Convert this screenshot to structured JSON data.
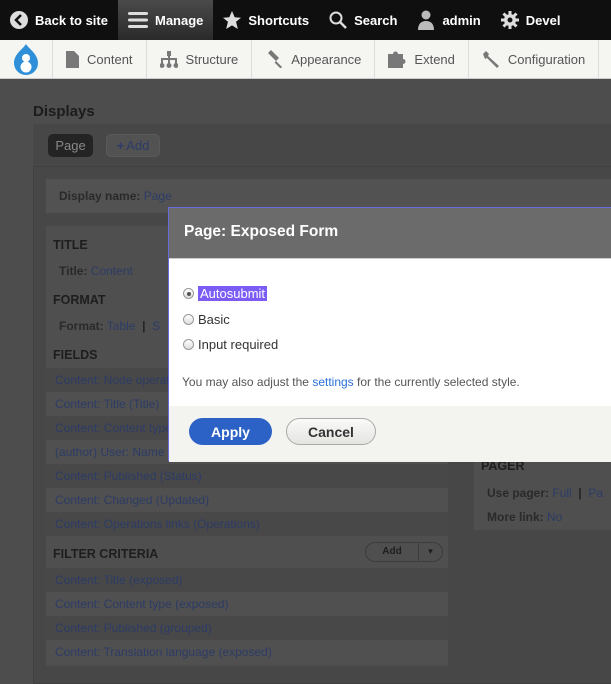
{
  "toolbar": {
    "items": [
      {
        "label": "Back to site",
        "icon": "chevron-left-circle-icon"
      },
      {
        "label": "Manage",
        "icon": "hamburger-icon"
      },
      {
        "label": "Shortcuts",
        "icon": "star-icon"
      },
      {
        "label": "Search",
        "icon": "search-icon"
      },
      {
        "label": "admin",
        "icon": "user-icon"
      },
      {
        "label": "Devel",
        "icon": "gear-icon"
      }
    ]
  },
  "tray": {
    "items": [
      {
        "label": "Content",
        "icon": "file-icon"
      },
      {
        "label": "Structure",
        "icon": "sitemap-icon"
      },
      {
        "label": "Appearance",
        "icon": "paintbrush-icon"
      },
      {
        "label": "Extend",
        "icon": "puzzle-icon"
      },
      {
        "label": "Configuration",
        "icon": "wrench-icon"
      }
    ]
  },
  "displays": {
    "heading": "Displays",
    "tab_page": "Page",
    "add": "Add",
    "display_name_label": "Display name:",
    "display_name": "Page"
  },
  "title_section": {
    "heading": "TITLE",
    "label": "Title:",
    "value": "Content"
  },
  "format_section": {
    "heading": "FORMAT",
    "label": "Format:",
    "value": "Table",
    "sep": "|",
    "value2": "S"
  },
  "fields": {
    "heading": "FIELDS",
    "items": [
      "Content: Node operat",
      "Content: Title (Title)",
      "Content: Content type",
      "(author) User: Name",
      "Content: Published (Status)",
      "Content: Changed (Updated)",
      "Content: Operations links (Operations)"
    ]
  },
  "filters": {
    "heading": "FILTER CRITERIA",
    "add": "Add",
    "items": [
      "Content: Title (exposed)",
      "Content: Content type (exposed)",
      "Content: Published (grouped)",
      "Content: Translation language (exposed)"
    ]
  },
  "pager": {
    "heading": "PAGER",
    "use_pager_label": "Use pager:",
    "use_pager": "Full",
    "sep": "|",
    "use_pager2": "Pa",
    "more_link_label": "More link:",
    "more_link": "No"
  },
  "modal": {
    "title": "Page: Exposed Form",
    "options": [
      "Autosubmit",
      "Basic",
      "Input required"
    ],
    "selected": "Autosubmit",
    "note_before": "You may also adjust the ",
    "note_link": "settings",
    "note_after": " for the currently selected style.",
    "apply": "Apply",
    "cancel": "Cancel"
  },
  "colors": {
    "toolbar": "#0f0f0f",
    "primary_button": "#2c62c6",
    "selection": "#7b5cf5",
    "drupal_blue": "#2f8fd8"
  }
}
